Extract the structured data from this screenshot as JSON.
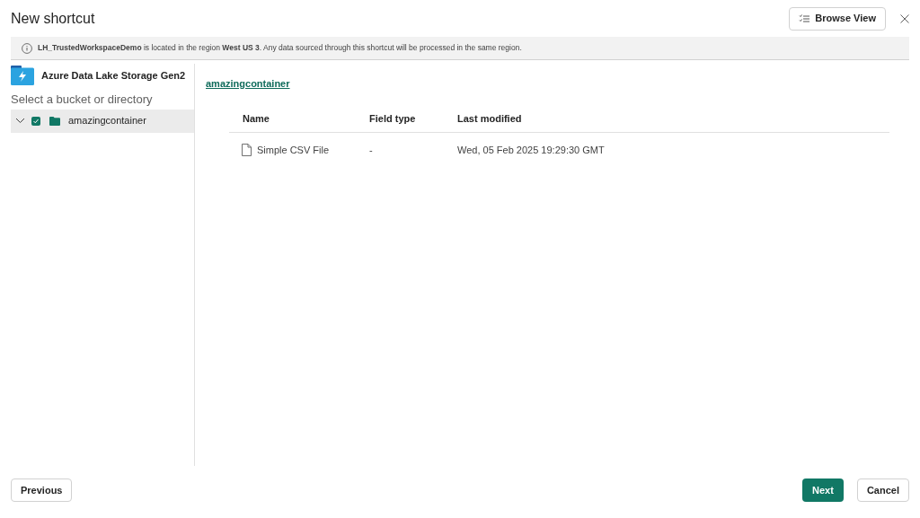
{
  "dialog": {
    "title": "New shortcut"
  },
  "toolbar": {
    "browse_view": "Browse View"
  },
  "notice": "**LH_TrustedWorkspaceDemo** is located in the region **West US 3**. Any data sourced through this shortcut will be processed in the same region.",
  "source": {
    "name": "Azure Data Lake Storage Gen2"
  },
  "tree": {
    "heading": "Select a bucket or directory",
    "items": [
      {
        "label": "amazingcontainer",
        "expanded": true,
        "checked": true,
        "selected": true
      }
    ]
  },
  "breadcrumb": "amazingcontainer",
  "table": {
    "columns": [
      "Name",
      "Field type",
      "Last modified"
    ],
    "rows": [
      {
        "cells": [
          "Simple CSV File",
          "-",
          "Wed, 05 Feb 2025 19:29:30 GMT"
        ]
      }
    ]
  },
  "footer": {
    "previous": "Previous",
    "next": "Next",
    "cancel": "Cancel"
  }
}
